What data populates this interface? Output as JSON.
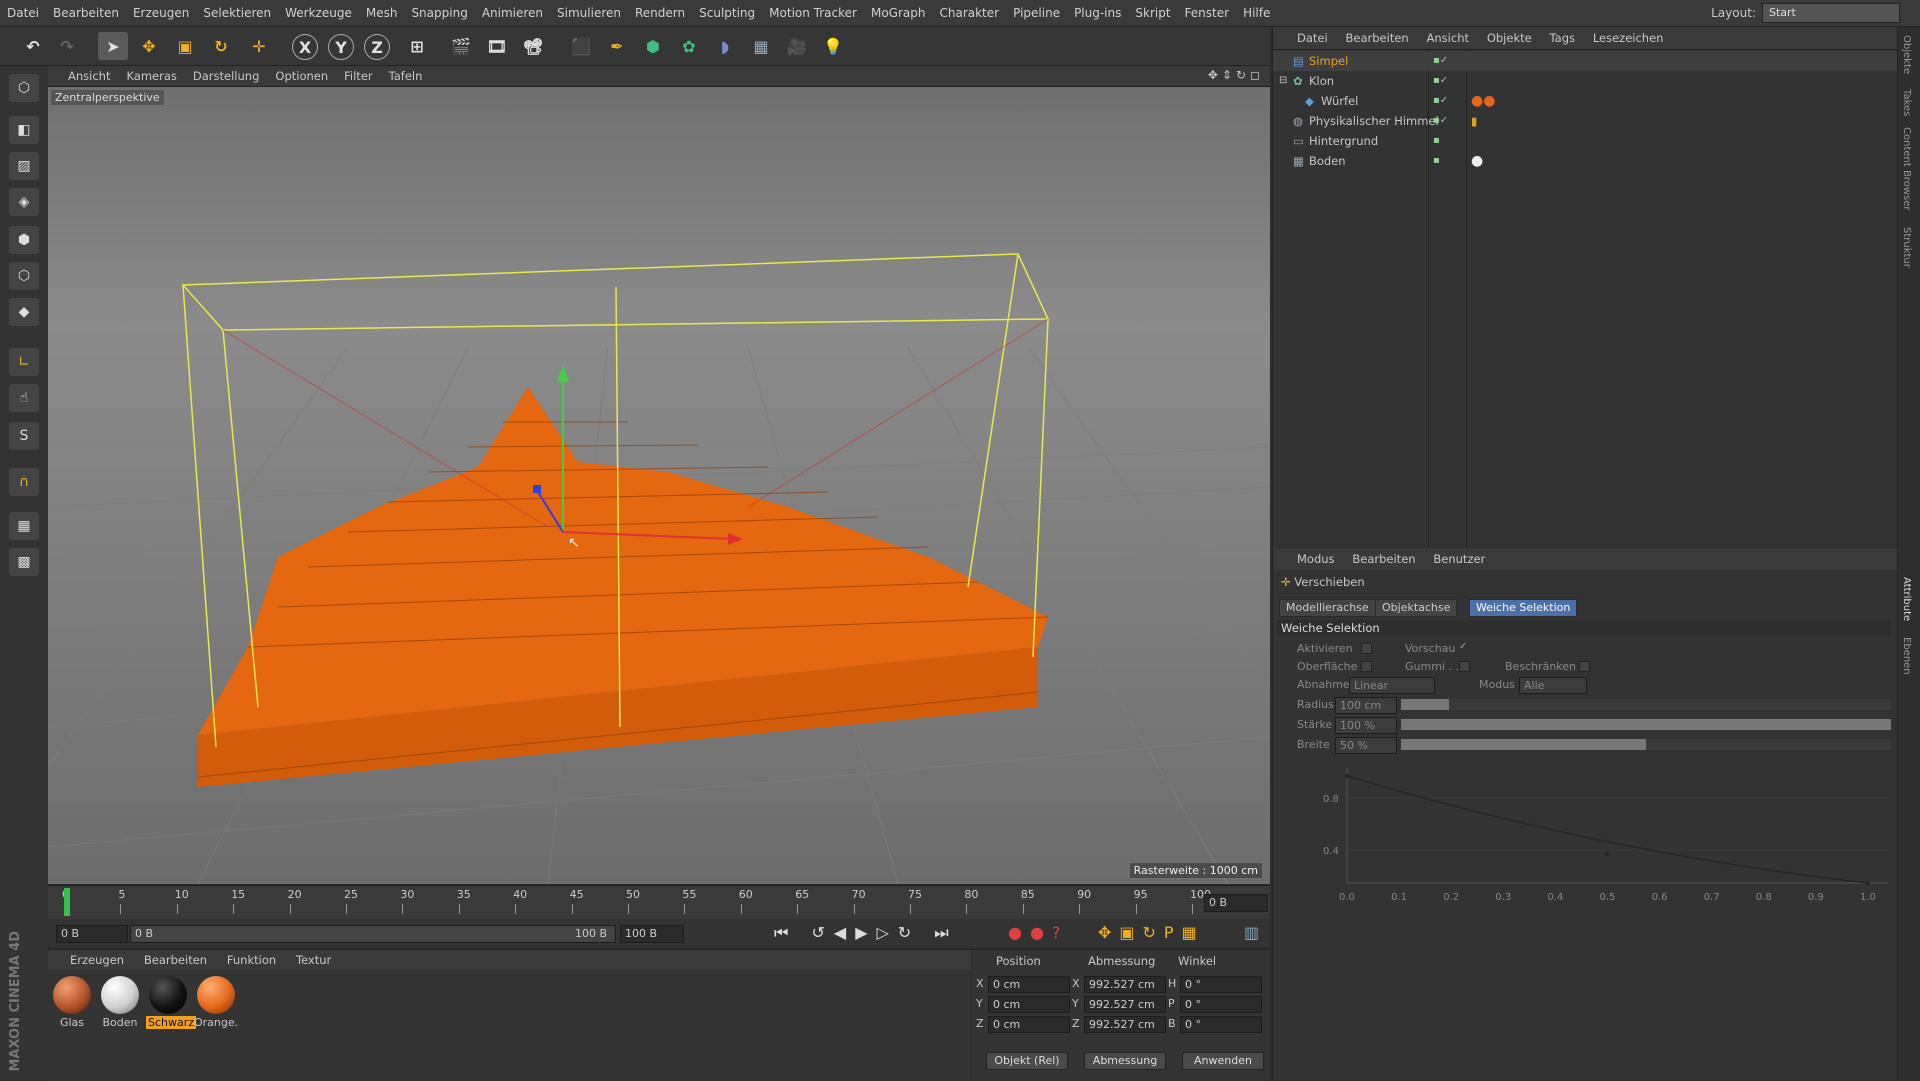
{
  "menu": [
    "Datei",
    "Bearbeiten",
    "Erzeugen",
    "Selektieren",
    "Werkzeuge",
    "Mesh",
    "Snapping",
    "Animieren",
    "Simulieren",
    "Rendern",
    "Sculpting",
    "Motion Tracker",
    "MoGraph",
    "Charakter",
    "Pipeline",
    "Plug-ins",
    "Skript",
    "Fenster",
    "Hilfe"
  ],
  "layout": {
    "label": "Layout:",
    "value": "Start"
  },
  "toolbar": {
    "x": "X",
    "y": "Y",
    "z": "Z"
  },
  "viewport": {
    "menu": [
      "Ansicht",
      "Kameras",
      "Darstellung",
      "Optionen",
      "Filter",
      "Tafeln"
    ],
    "label": "Zentralperspektive",
    "raster": "Rasterweite : 1000 cm"
  },
  "timeline": {
    "ticks": [
      "0",
      "5",
      "10",
      "15",
      "20",
      "25",
      "30",
      "35",
      "40",
      "45",
      "50",
      "55",
      "60",
      "65",
      "70",
      "75",
      "80",
      "85",
      "90",
      "95",
      "100"
    ],
    "frame_end_field": "0 B",
    "start_field": "0 B",
    "range_start": "0 B",
    "range_end": "100 B",
    "end_field": "100 B"
  },
  "material_manager": {
    "menu": [
      "Erzeugen",
      "Bearbeiten",
      "Funktion",
      "Textur"
    ],
    "materials": [
      {
        "name": "Glas",
        "color": "#b5532c"
      },
      {
        "name": "Boden",
        "color": "#e8e8e8"
      },
      {
        "name": "Schwarz",
        "color": "#111111"
      },
      {
        "name": "Orange.",
        "color": "#e5661a"
      }
    ]
  },
  "coordinates": {
    "headers": [
      "Position",
      "Abmessung",
      "Winkel"
    ],
    "rows": [
      {
        "axis": "X",
        "pos": "0 cm",
        "dim_axis": "X",
        "dim": "992.527 cm",
        "ang_axis": "H",
        "ang": "0 °"
      },
      {
        "axis": "Y",
        "pos": "0 cm",
        "dim_axis": "Y",
        "dim": "992.527 cm",
        "ang_axis": "P",
        "ang": "0 °"
      },
      {
        "axis": "Z",
        "pos": "0 cm",
        "dim_axis": "Z",
        "dim": "992.527 cm",
        "ang_axis": "B",
        "ang": "0 °"
      }
    ],
    "mode_select": "Objekt (Rel)",
    "size_select": "Abmessung",
    "apply": "Anwenden"
  },
  "object_manager": {
    "menu": [
      "Datei",
      "Bearbeiten",
      "Ansicht",
      "Objekte",
      "Tags",
      "Lesezeichen"
    ],
    "objects": [
      "Simpel",
      "Klon",
      "Würfel",
      "Physikalischer Himmel",
      "Hintergrund",
      "Boden"
    ]
  },
  "attribute_manager": {
    "menu": [
      "Modus",
      "Bearbeiten",
      "Benutzer"
    ],
    "tool": "Verschieben",
    "tabs": [
      "Modellierachse",
      "Objektachse",
      "Weiche Selektion"
    ],
    "section": "Weiche Selektion",
    "aktivieren": "Aktivieren",
    "vorschau": "Vorschau",
    "oberflaeche": "Oberfläche",
    "gummi": "Gummi . .",
    "beschraenken": "Beschränken",
    "abnahme_label": "Abnahme",
    "abnahme_value": "Linear",
    "modus_label": "Modus",
    "modus_value": "Alle",
    "radius_label": "Radius",
    "radius_value": "100 cm",
    "staerke_label": "Stärke",
    "staerke_value": "100 %",
    "breite_label": "Breite",
    "breite_value": "50 %",
    "graph_y": [
      "0.8",
      "0.4"
    ],
    "graph_x": [
      "0.0",
      "0.1",
      "0.2",
      "0.3",
      "0.4",
      "0.5",
      "0.6",
      "0.7",
      "0.8",
      "0.9",
      "1.0"
    ]
  },
  "right_tabs": [
    "Objekte",
    "Takes",
    "Content Browser",
    "Struktur",
    "Attribute",
    "Ebenen"
  ],
  "brand": "MAXON CINEMA 4D"
}
